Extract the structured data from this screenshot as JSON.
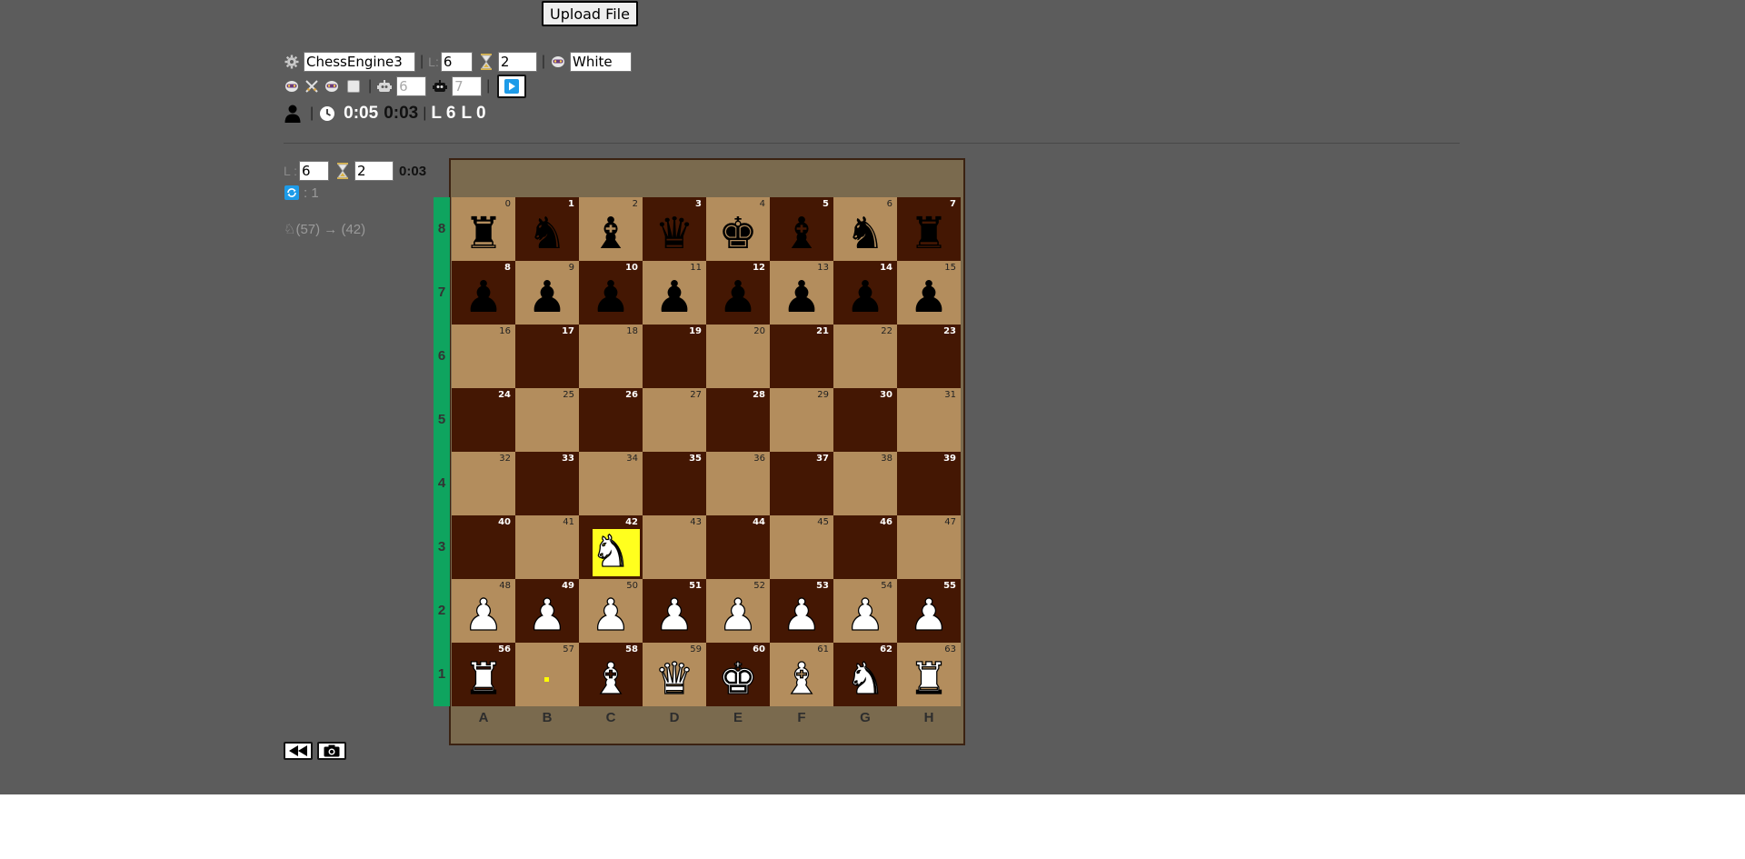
{
  "upload": {
    "label": "Upload File"
  },
  "engine": {
    "name": "ChessEngine3",
    "level_label": "L:",
    "level": "6",
    "time": "2",
    "side": "White"
  },
  "auto": {
    "robot1_value": "6",
    "robot2_value": "7"
  },
  "status": {
    "sep": "|",
    "clock_white": "0:05",
    "clock_black": "0:03",
    "level_white": "L 6",
    "level_black": "L 0"
  },
  "panel": {
    "level_label": "L :",
    "level": "6",
    "time": "2",
    "elapsed": "0:03",
    "refresh_count": ": 1",
    "last_move": "♘(57) → (42)"
  },
  "board": {
    "files": [
      "A",
      "B",
      "C",
      "D",
      "E",
      "F",
      "G",
      "H"
    ],
    "ranks": [
      "8",
      "7",
      "6",
      "5",
      "4",
      "3",
      "2",
      "1"
    ],
    "pieces": {
      "0": "♜b",
      "1": "♞b",
      "2": "♝b",
      "3": "♛b",
      "4": "♚b",
      "5": "♝b",
      "6": "♞b",
      "7": "♜b",
      "8": "♟b",
      "9": "♟b",
      "10": "♟b",
      "11": "♟b",
      "12": "♟b",
      "13": "♟b",
      "14": "♟b",
      "15": "♟b",
      "42": "♞w",
      "48": "♟w",
      "49": "♟w",
      "50": "♟w",
      "51": "♟w",
      "52": "♟w",
      "53": "♟w",
      "54": "♟w",
      "55": "♟w",
      "56": "♜w",
      "58": "♝w",
      "59": "♛w",
      "60": "♚w",
      "61": "♝w",
      "62": "♞w",
      "63": "♜w"
    },
    "highlight_square": 42,
    "move_origin_square": 57
  },
  "colors": {
    "background": "#5c5c5c",
    "light_square": "#b38d5d",
    "dark_square": "#441703",
    "rank_bar": "#0fa45f",
    "highlight": "#ffff1e"
  },
  "icons": {
    "engine": "gear-icon",
    "time": "hourglass-icon",
    "player": "robot-face-icon",
    "versus": "crossed-swords-icon",
    "robot": "robot-icon",
    "play": "play-icon",
    "person": "person-icon",
    "clock": "clock-icon",
    "refresh": "refresh-icon",
    "rewind": "rewind-icon",
    "camera": "camera-icon"
  }
}
